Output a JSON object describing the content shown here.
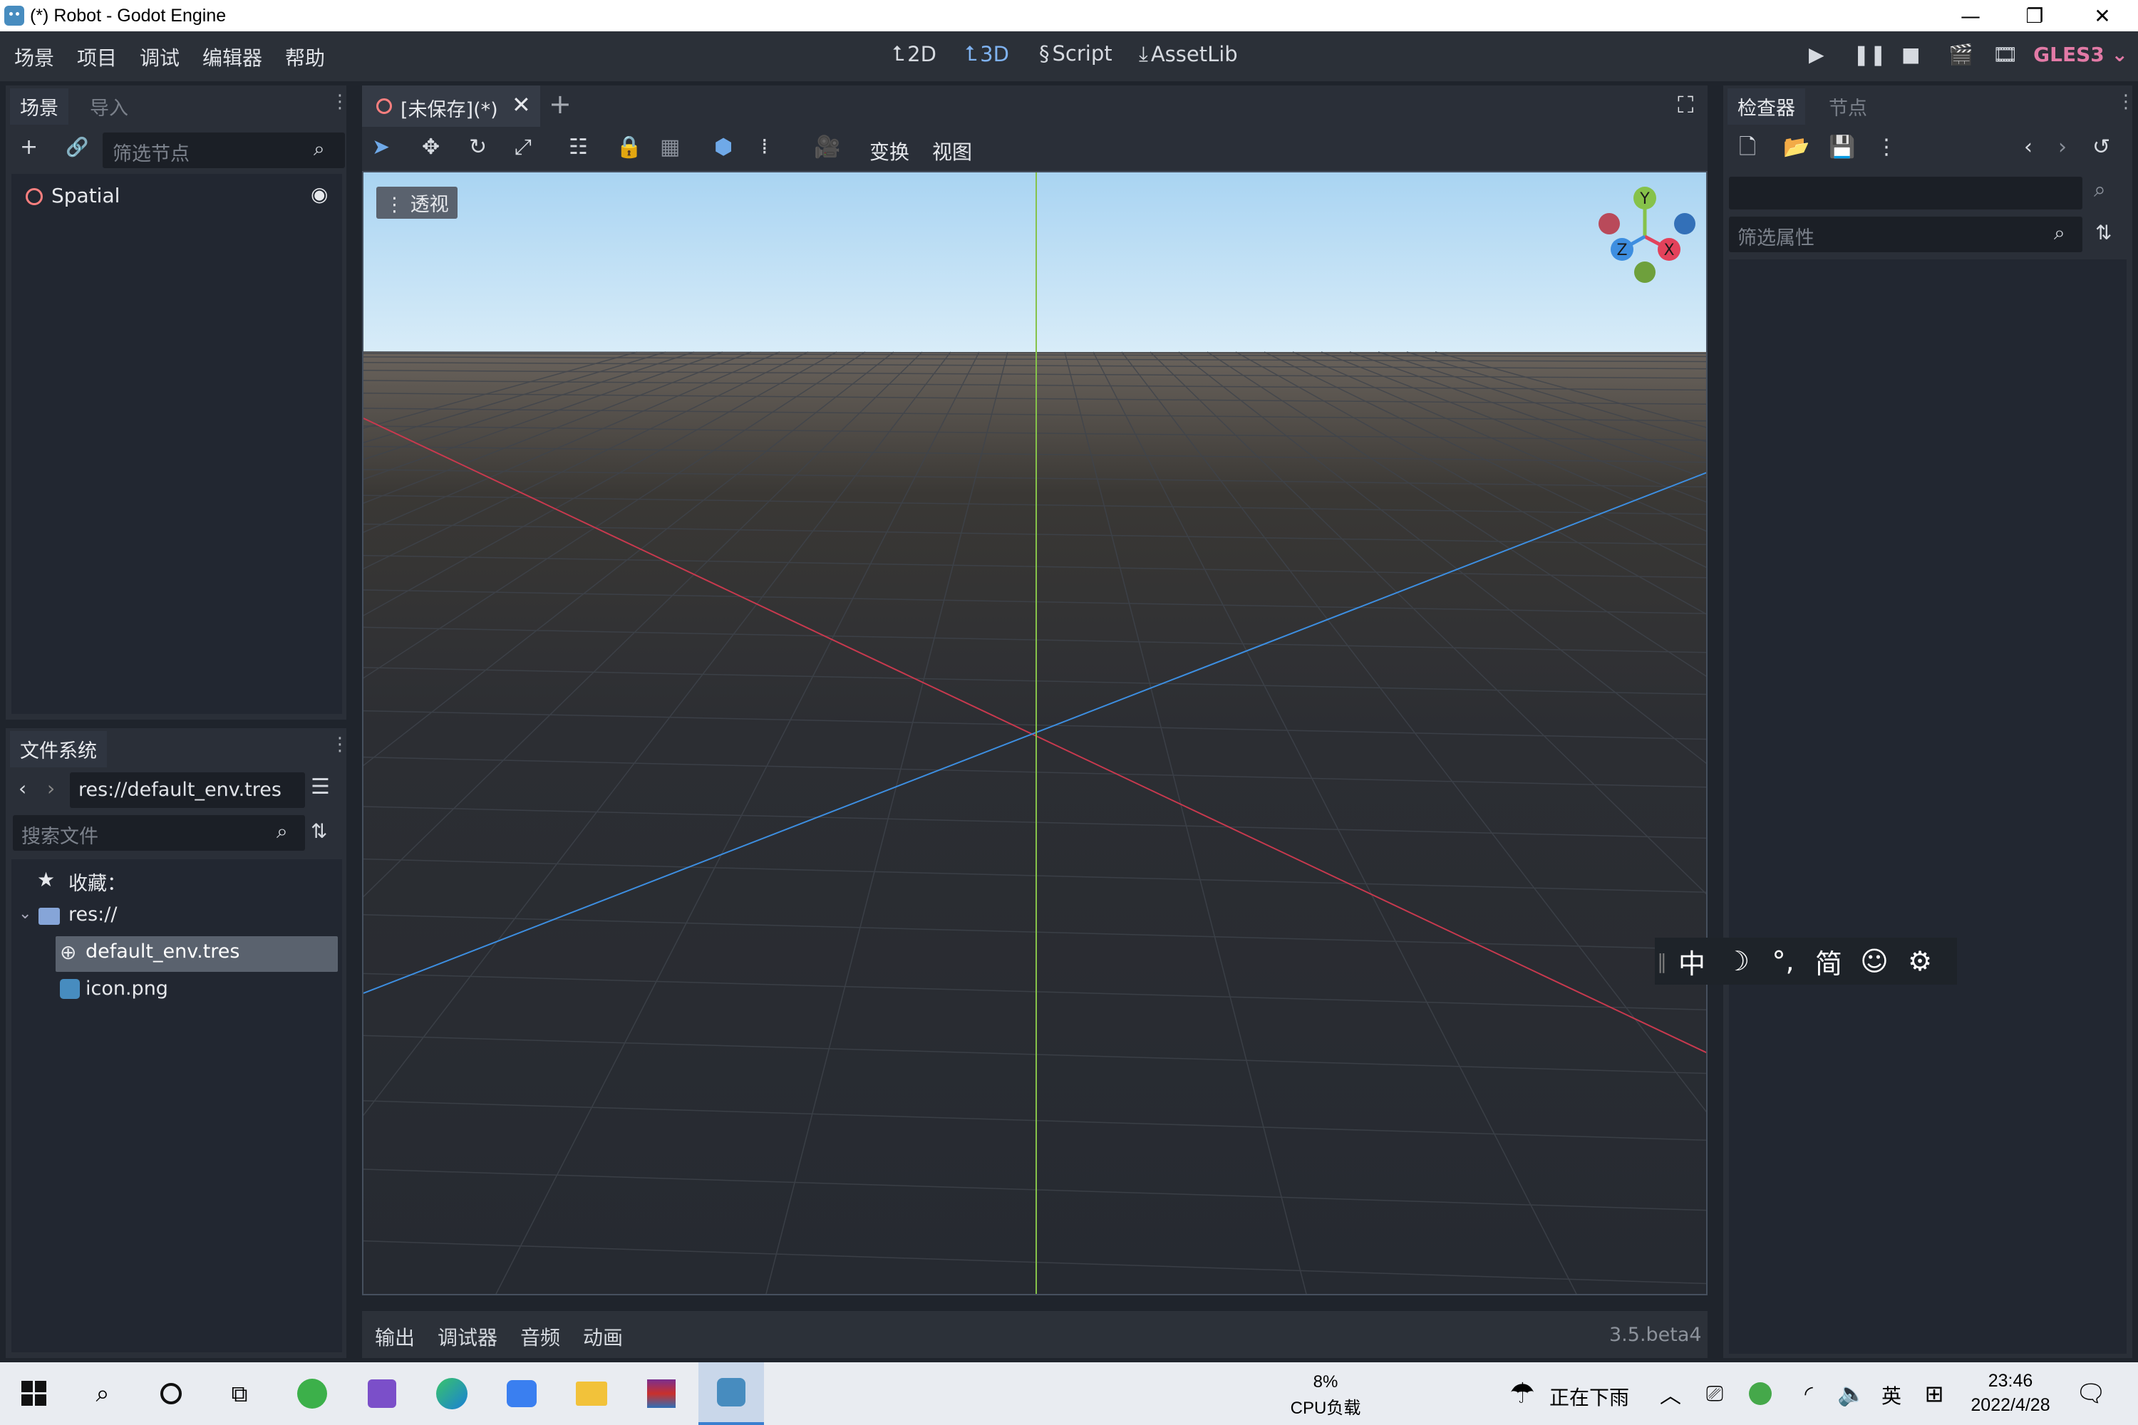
{
  "window": {
    "title": "(*) Robot - Godot Engine"
  },
  "menu": [
    "场景",
    "项目",
    "调试",
    "编辑器",
    "帮助"
  ],
  "workspaces": {
    "2d": "2D",
    "3d": "3D",
    "script": "Script",
    "assetlib": "AssetLib"
  },
  "renderer": "GLES3",
  "scene_panel": {
    "tabs": [
      "场景",
      "导入"
    ],
    "filter_placeholder": "筛选节点",
    "root_node": "Spatial"
  },
  "filesystem_panel": {
    "tab": "文件系统",
    "path": "res://default_env.tres",
    "search_placeholder": "搜索文件",
    "favorites_label": "收藏：",
    "root_label": "res://",
    "files": [
      "default_env.tres",
      "icon.png"
    ]
  },
  "editor": {
    "scene_tab": "[未保存](*)",
    "toolbar_menus": [
      "变换",
      "视图"
    ],
    "perspective_label": "透视",
    "gizmo": {
      "y": "Y",
      "x": "X",
      "z": "Z"
    }
  },
  "bottom_panel": {
    "tabs": [
      "输出",
      "调试器",
      "音频",
      "动画"
    ],
    "version": "3.5.beta4"
  },
  "inspector_panel": {
    "tabs": [
      "检查器",
      "节点"
    ],
    "filter_placeholder": "筛选属性"
  },
  "ime": [
    "中",
    "☽",
    "°,",
    "简",
    "☺",
    "⚙"
  ],
  "taskbar": {
    "cpu_percent": "8%",
    "cpu_label": "CPU负载",
    "weather": "正在下雨",
    "lang": "英",
    "time": "23:46",
    "date": "2022/4/28"
  },
  "colors": {
    "x_axis": "#c8394e",
    "y_axis": "#86c24a",
    "z_axis": "#3d8ee0",
    "accent": "#7fb2f0",
    "renderer": "#e27aa6"
  }
}
